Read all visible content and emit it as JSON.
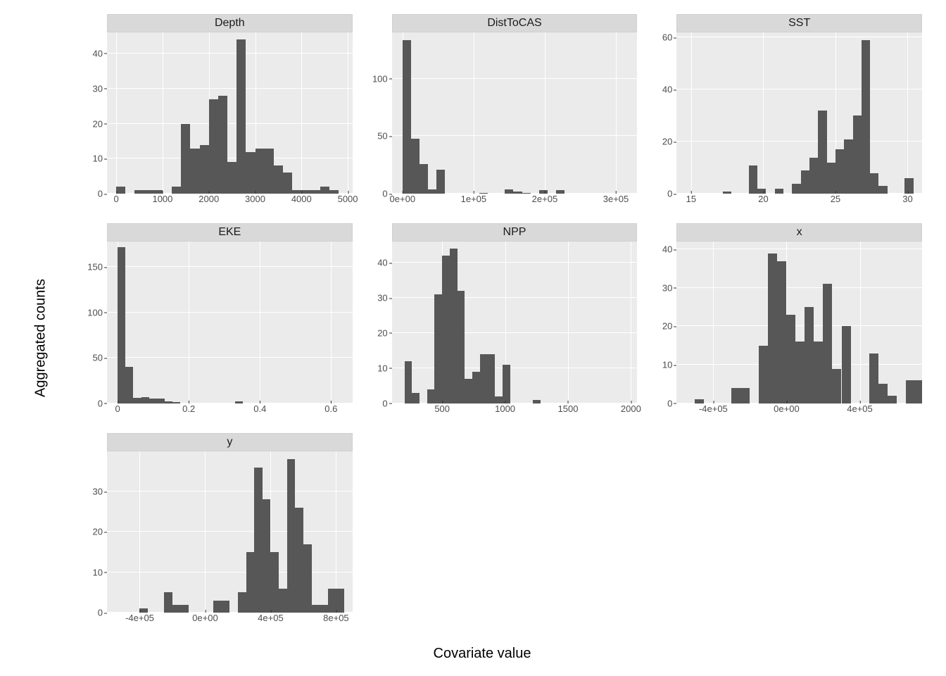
{
  "axis_labels": {
    "x": "Covariate value",
    "y": "Aggregated counts"
  },
  "chart_data": [
    {
      "name": "Depth",
      "type": "bar",
      "xlabel": "",
      "ylabel": "",
      "xlim": [
        -200,
        5100
      ],
      "ylim": [
        0,
        46
      ],
      "x_ticks": [
        0,
        1000,
        2000,
        3000,
        4000,
        5000
      ],
      "y_ticks": [
        0,
        10,
        20,
        30,
        40
      ],
      "bin_width": 200,
      "bars": [
        {
          "x": 0,
          "y": 2
        },
        {
          "x": 400,
          "y": 1
        },
        {
          "x": 600,
          "y": 1
        },
        {
          "x": 800,
          "y": 1
        },
        {
          "x": 1200,
          "y": 2
        },
        {
          "x": 1400,
          "y": 20
        },
        {
          "x": 1600,
          "y": 13
        },
        {
          "x": 1800,
          "y": 14
        },
        {
          "x": 2000,
          "y": 27
        },
        {
          "x": 2200,
          "y": 28
        },
        {
          "x": 2400,
          "y": 9
        },
        {
          "x": 2600,
          "y": 44
        },
        {
          "x": 2800,
          "y": 12
        },
        {
          "x": 3000,
          "y": 13
        },
        {
          "x": 3200,
          "y": 13
        },
        {
          "x": 3400,
          "y": 8
        },
        {
          "x": 3600,
          "y": 6
        },
        {
          "x": 3800,
          "y": 1
        },
        {
          "x": 4000,
          "y": 1
        },
        {
          "x": 4200,
          "y": 1
        },
        {
          "x": 4400,
          "y": 2
        },
        {
          "x": 4600,
          "y": 1
        }
      ]
    },
    {
      "name": "DistToCAS",
      "type": "bar",
      "xlabel": "",
      "ylabel": "",
      "xlim": [
        -15000,
        330000
      ],
      "ylim": [
        0,
        140
      ],
      "x_ticks": [
        0,
        100000,
        200000,
        300000
      ],
      "x_tick_labels": [
        "0e+00",
        "1e+05",
        "2e+05",
        "3e+05"
      ],
      "y_ticks": [
        0,
        50,
        100
      ],
      "bin_width": 12000,
      "bars": [
        {
          "x": 0,
          "y": 133
        },
        {
          "x": 12000,
          "y": 48
        },
        {
          "x": 24000,
          "y": 26
        },
        {
          "x": 36000,
          "y": 4
        },
        {
          "x": 48000,
          "y": 21
        },
        {
          "x": 108000,
          "y": 1
        },
        {
          "x": 144000,
          "y": 4
        },
        {
          "x": 156000,
          "y": 2
        },
        {
          "x": 168000,
          "y": 1
        },
        {
          "x": 192000,
          "y": 3
        },
        {
          "x": 216000,
          "y": 3
        }
      ]
    },
    {
      "name": "SST",
      "type": "bar",
      "xlabel": "",
      "ylabel": "",
      "xlim": [
        14,
        31
      ],
      "ylim": [
        0,
        62
      ],
      "x_ticks": [
        15,
        20,
        25,
        30
      ],
      "y_ticks": [
        0,
        20,
        40,
        60
      ],
      "bin_width": 0.6,
      "bars": [
        {
          "x": 17.2,
          "y": 1
        },
        {
          "x": 19.0,
          "y": 11
        },
        {
          "x": 19.6,
          "y": 2
        },
        {
          "x": 20.8,
          "y": 2
        },
        {
          "x": 22.0,
          "y": 4
        },
        {
          "x": 22.6,
          "y": 9
        },
        {
          "x": 23.2,
          "y": 14
        },
        {
          "x": 23.8,
          "y": 32
        },
        {
          "x": 24.4,
          "y": 12
        },
        {
          "x": 25.0,
          "y": 17
        },
        {
          "x": 25.6,
          "y": 21
        },
        {
          "x": 26.2,
          "y": 30
        },
        {
          "x": 26.8,
          "y": 59
        },
        {
          "x": 27.4,
          "y": 8
        },
        {
          "x": 28.0,
          "y": 3
        },
        {
          "x": 29.8,
          "y": 6
        }
      ]
    },
    {
      "name": "EKE",
      "type": "bar",
      "xlabel": "",
      "ylabel": "",
      "xlim": [
        -0.03,
        0.66
      ],
      "ylim": [
        0,
        178
      ],
      "x_ticks": [
        0.0,
        0.2,
        0.4,
        0.6
      ],
      "y_ticks": [
        0,
        50,
        100,
        150
      ],
      "bin_width": 0.022,
      "bars": [
        {
          "x": 0.0,
          "y": 172
        },
        {
          "x": 0.022,
          "y": 40
        },
        {
          "x": 0.044,
          "y": 6
        },
        {
          "x": 0.066,
          "y": 7
        },
        {
          "x": 0.088,
          "y": 5
        },
        {
          "x": 0.11,
          "y": 5
        },
        {
          "x": 0.132,
          "y": 2
        },
        {
          "x": 0.154,
          "y": 1
        },
        {
          "x": 0.33,
          "y": 2
        }
      ]
    },
    {
      "name": "NPP",
      "type": "bar",
      "xlabel": "",
      "ylabel": "",
      "xlim": [
        100,
        2050
      ],
      "ylim": [
        0,
        46
      ],
      "x_ticks": [
        500,
        1000,
        1500,
        2000
      ],
      "y_ticks": [
        0,
        10,
        20,
        30,
        40
      ],
      "bin_width": 60,
      "bars": [
        {
          "x": 200,
          "y": 12
        },
        {
          "x": 260,
          "y": 3
        },
        {
          "x": 380,
          "y": 4
        },
        {
          "x": 440,
          "y": 31
        },
        {
          "x": 500,
          "y": 42
        },
        {
          "x": 560,
          "y": 44
        },
        {
          "x": 620,
          "y": 32
        },
        {
          "x": 680,
          "y": 7
        },
        {
          "x": 740,
          "y": 9
        },
        {
          "x": 800,
          "y": 14
        },
        {
          "x": 860,
          "y": 14
        },
        {
          "x": 920,
          "y": 2
        },
        {
          "x": 980,
          "y": 11
        },
        {
          "x": 1220,
          "y": 1
        }
      ]
    },
    {
      "name": "x",
      "type": "bar",
      "xlabel": "",
      "ylabel": "",
      "xlim": [
        -600000,
        740000
      ],
      "ylim": [
        0,
        42
      ],
      "x_ticks": [
        -400000,
        0,
        400000
      ],
      "x_tick_labels": [
        "-4e+05",
        "0e+00",
        "4e+05"
      ],
      "y_ticks": [
        0,
        10,
        20,
        30,
        40
      ],
      "bin_width": 50000,
      "bars": [
        {
          "x": -500000,
          "y": 1
        },
        {
          "x": -300000,
          "y": 4
        },
        {
          "x": -250000,
          "y": 4
        },
        {
          "x": -150000,
          "y": 15
        },
        {
          "x": -100000,
          "y": 39
        },
        {
          "x": -50000,
          "y": 37
        },
        {
          "x": 0,
          "y": 23
        },
        {
          "x": 50000,
          "y": 16
        },
        {
          "x": 100000,
          "y": 25
        },
        {
          "x": 150000,
          "y": 16
        },
        {
          "x": 200000,
          "y": 31
        },
        {
          "x": 250000,
          "y": 9
        },
        {
          "x": 300000,
          "y": 20
        },
        {
          "x": 450000,
          "y": 13
        },
        {
          "x": 500000,
          "y": 5
        },
        {
          "x": 550000,
          "y": 2
        },
        {
          "x": 650000,
          "y": 6
        },
        {
          "x": 700000,
          "y": 6
        }
      ]
    },
    {
      "name": "y",
      "type": "bar",
      "xlabel": "",
      "ylabel": "",
      "xlim": [
        -600000,
        900000
      ],
      "ylim": [
        0,
        40
      ],
      "x_ticks": [
        -400000,
        0,
        400000,
        800000
      ],
      "x_tick_labels": [
        "-4e+05",
        "0e+00",
        "4e+05",
        "8e+05"
      ],
      "y_ticks": [
        0,
        10,
        20,
        30
      ],
      "bin_width": 50000,
      "bars": [
        {
          "x": -400000,
          "y": 1
        },
        {
          "x": -250000,
          "y": 5
        },
        {
          "x": -200000,
          "y": 2
        },
        {
          "x": -150000,
          "y": 2
        },
        {
          "x": 50000,
          "y": 3
        },
        {
          "x": 100000,
          "y": 3
        },
        {
          "x": 200000,
          "y": 5
        },
        {
          "x": 250000,
          "y": 15
        },
        {
          "x": 300000,
          "y": 36
        },
        {
          "x": 350000,
          "y": 28
        },
        {
          "x": 400000,
          "y": 15
        },
        {
          "x": 450000,
          "y": 6
        },
        {
          "x": 500000,
          "y": 38
        },
        {
          "x": 550000,
          "y": 26
        },
        {
          "x": 600000,
          "y": 17
        },
        {
          "x": 650000,
          "y": 2
        },
        {
          "x": 700000,
          "y": 2
        },
        {
          "x": 750000,
          "y": 6
        },
        {
          "x": 800000,
          "y": 6
        }
      ]
    }
  ]
}
